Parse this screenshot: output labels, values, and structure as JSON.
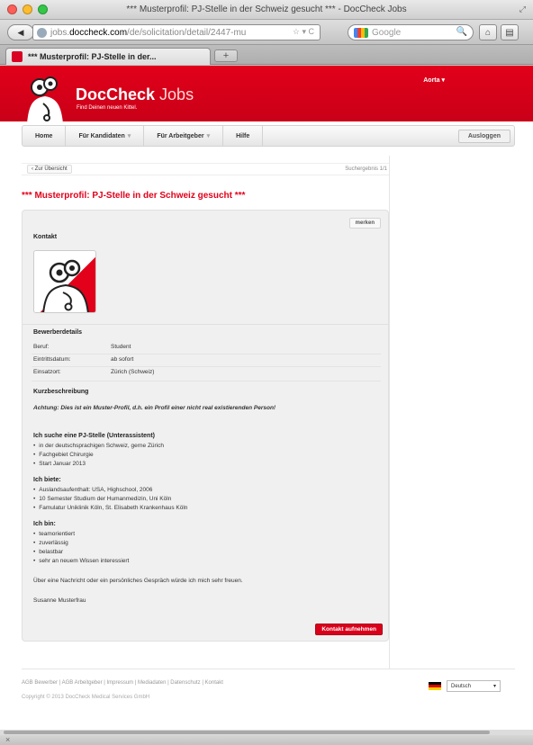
{
  "window": {
    "title": "*** Musterprofil: PJ-Stelle in der Schweiz gesucht *** - DocCheck Jobs"
  },
  "browser": {
    "url_prefix": "jobs.",
    "url_host": "doccheck.com",
    "url_path": "/de/solicitation/detail/2447-mu",
    "search_placeholder": "Google",
    "tab_title": "*** Musterprofil: PJ-Stelle in der..."
  },
  "site": {
    "brand_main": "DocCheck",
    "brand_sub": "Jobs",
    "tagline": "Find Deinen neuen Kittel.",
    "user_menu": "Aorta",
    "nav": [
      "Home",
      "Für Kandidaten",
      "Für Arbeitgeber",
      "Hilfe"
    ],
    "logout": "Ausloggen",
    "back_link": "‹ Zur Übersicht",
    "result_count": "Suchergebnis 1/1"
  },
  "profile": {
    "title": "*** Musterprofil: PJ-Stelle in der Schweiz gesucht ***",
    "merken": "merken",
    "contact_heading": "Kontakt",
    "details_heading": "Bewerberdetails",
    "details": [
      {
        "key": "Beruf:",
        "value": "Student"
      },
      {
        "key": "Eintrittsdatum:",
        "value": "ab sofort"
      },
      {
        "key": "Einsatzort:",
        "value": "Zürich (Schweiz)"
      }
    ],
    "summary_heading": "Kurzbeschreibung",
    "warning": "Achtung: Dies ist ein Muster-Profil, d.h. ein Profil einer nicht real existierenden Person!",
    "search_heading": "Ich suche eine PJ-Stelle (Unterassistent)",
    "search_items": [
      "in der deutschsprachigen Schweiz, gerne Zürich",
      "Fachgebiet Chirurgie",
      "Start Januar 2013"
    ],
    "offer_heading": "Ich biete:",
    "offer_items": [
      "Auslandsaufenthalt: USA, Highschool, 2006",
      "10 Semester Studium der Humanmedizin, Uni Köln",
      "Famulatur Uniklinik Köln, St. Elisabeth Krankenhaus Köln"
    ],
    "am_heading": "Ich bin:",
    "am_items": [
      "teamorientiert",
      "zuverlässig",
      "belastbar",
      "sehr an neuem Wissen interessiert"
    ],
    "closing": "Über eine Nachricht oder ein persönliches Gespräch würde ich mich sehr freuen.",
    "signature": "Susanne Musterfrau",
    "contact_button": "Kontakt aufnehmen"
  },
  "footer": {
    "links": "AGB Bewerber | AGB Arbeitgeber | Impressum | Mediadaten | Datenschutz | Kontakt",
    "copyright": "Copyright © 2013 DocCheck Medical Services GmbH",
    "language": "Deutsch"
  },
  "colors": {
    "brand_red": "#e2001a"
  }
}
